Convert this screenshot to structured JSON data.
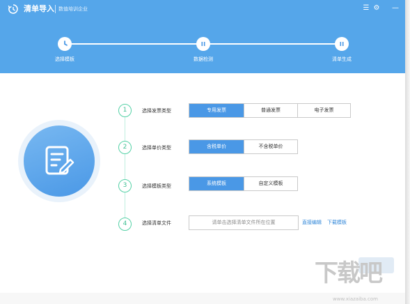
{
  "app": {
    "title": "清单导入",
    "company": "数值培训企业"
  },
  "title_bar_buttons": [
    {
      "name": "menu",
      "glyph": "☰"
    },
    {
      "name": "settings",
      "glyph": "⚙"
    },
    {
      "name": "minimize",
      "glyph": "—"
    }
  ],
  "steps": [
    {
      "label": "选择模板",
      "state": "current",
      "icon": "clock-icon"
    },
    {
      "label": "数据检测",
      "state": "pending",
      "icon": "pause-icon"
    },
    {
      "label": "清单生成",
      "state": "pending",
      "icon": "pause-icon"
    }
  ],
  "form": {
    "rows": [
      {
        "number": "1",
        "label": "选择发票类型",
        "options": [
          "专用发票",
          "普通发票",
          "电子发票"
        ],
        "selected": 0
      },
      {
        "number": "2",
        "label": "选择单价类型",
        "options": [
          "含税单价",
          "不含税单价"
        ],
        "selected": 0
      },
      {
        "number": "3",
        "label": "选择模板类型",
        "options": [
          "系统模板",
          "自定义模板"
        ],
        "selected": 0
      },
      {
        "number": "4",
        "label": "选择清单文件"
      }
    ],
    "file_placeholder": "请单击选择清单文件所在位置",
    "links": [
      "直接编辑",
      "下载模板"
    ]
  },
  "watermark": {
    "text": "下载吧",
    "url": "www.xiazaiba.com"
  },
  "colors": {
    "header": "#55a6ea",
    "accent": "#4a98e6",
    "step_number": "#3fbf93",
    "link": "#2f86d8"
  }
}
